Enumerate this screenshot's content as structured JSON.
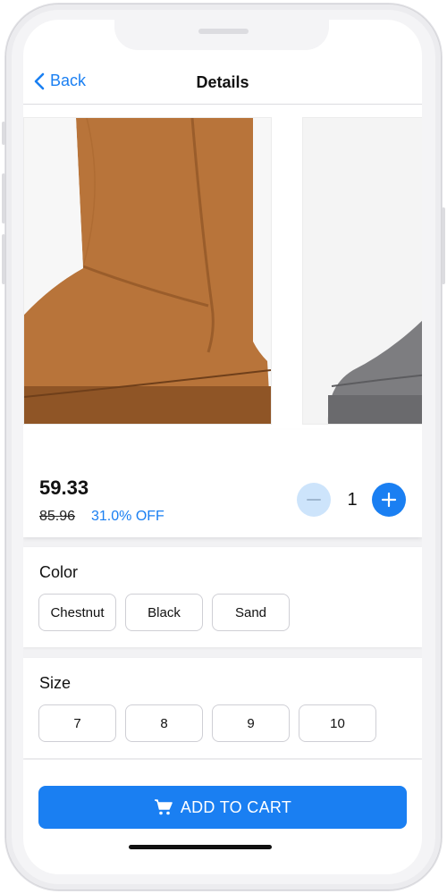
{
  "nav": {
    "back_label": "Back",
    "title": "Details"
  },
  "gallery": {
    "images": [
      "chestnut-boot",
      "grey-boot"
    ],
    "active_index": 0,
    "dot_count": 3
  },
  "product": {
    "price": "59.33",
    "original_price": "85.96",
    "discount": "31.0% OFF"
  },
  "quantity": {
    "value": "1"
  },
  "color_section": {
    "title": "Color",
    "options": [
      "Chestnut",
      "Black",
      "Sand"
    ]
  },
  "size_section": {
    "title": "Size",
    "options": [
      "7",
      "8",
      "9",
      "10"
    ]
  },
  "cart": {
    "button_label": "ADD TO CART",
    "icon": "cart-icon"
  },
  "colors": {
    "accent": "#1a7ff2",
    "accent_light": "#cde4fb",
    "boot_chestnut": "#b8743a",
    "boot_grey": "#7d7d80"
  }
}
